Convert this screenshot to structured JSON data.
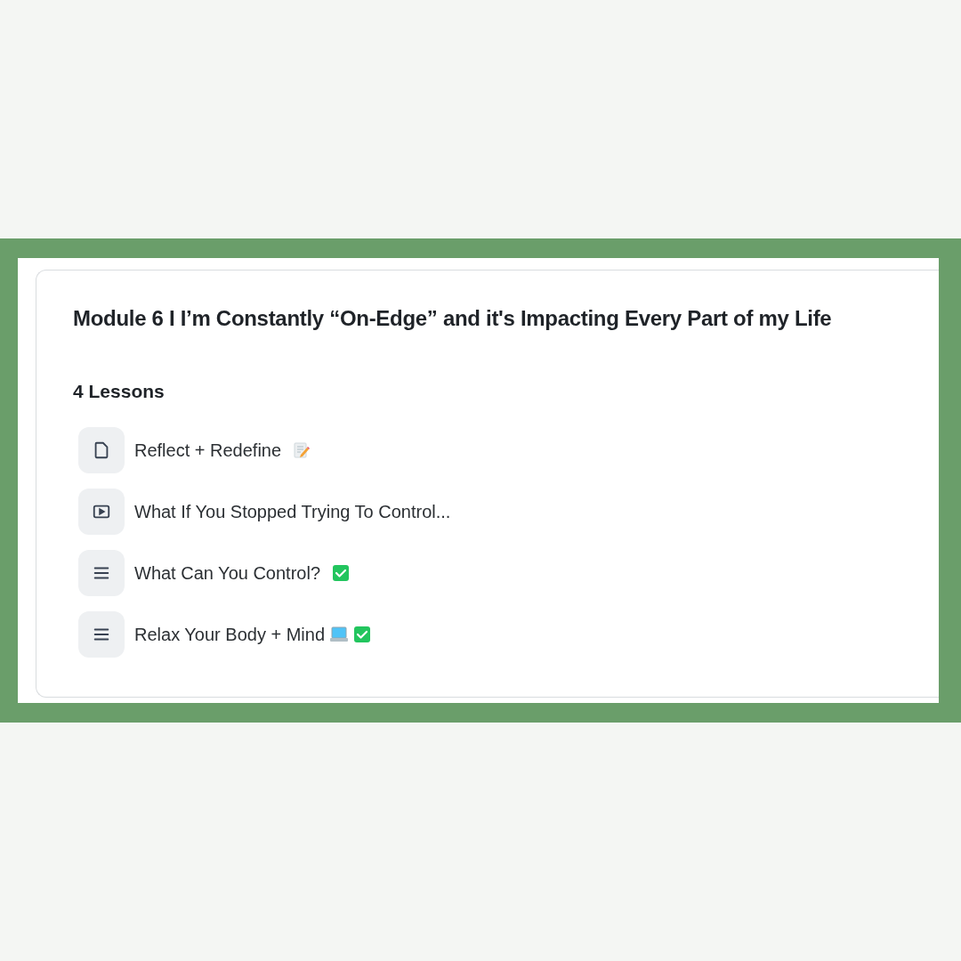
{
  "module": {
    "title": "Module 6 I I’m Constantly “On-Edge” and it's Impacting Every Part of my Life",
    "lesson_count": "4 Lessons",
    "lessons": [
      {
        "kind": "document",
        "title": "Reflect + Redefine",
        "trailing": [
          {
            "kind": "memo"
          }
        ]
      },
      {
        "kind": "video",
        "title": "What If You Stopped Trying To Control..."
      },
      {
        "kind": "text",
        "title": "What Can You Control?",
        "trailing": [
          {
            "kind": "check"
          }
        ]
      },
      {
        "kind": "text",
        "title": "Relax Your Body + Mind",
        "trailing": [
          {
            "kind": "laptop"
          },
          {
            "kind": "check"
          }
        ]
      }
    ]
  }
}
